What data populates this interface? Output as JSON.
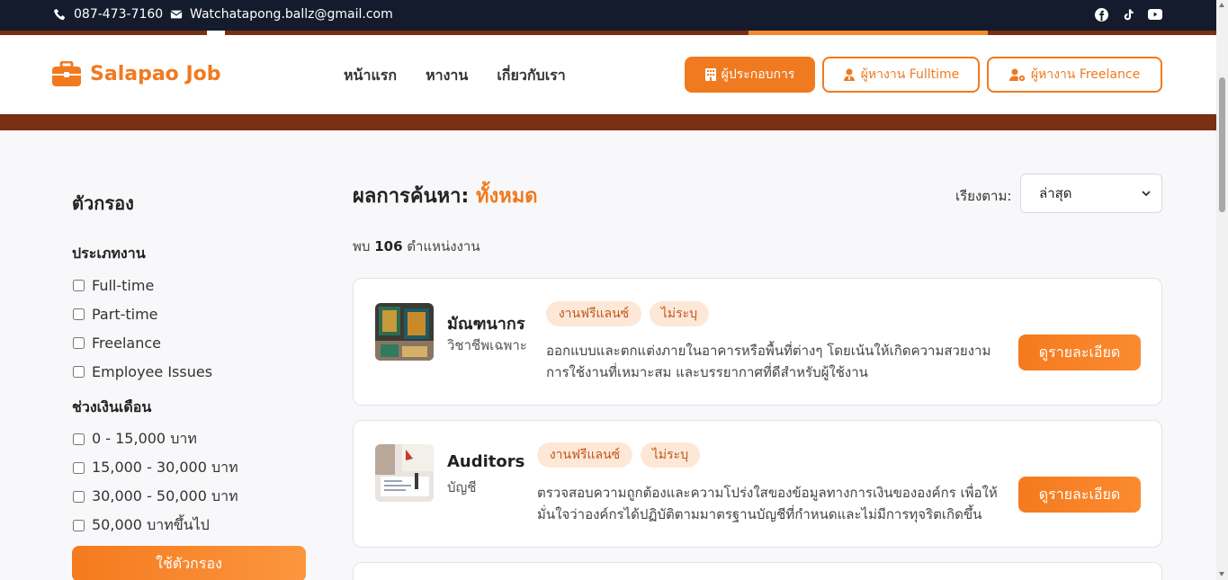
{
  "topbar": {
    "phone": "087-473-7160",
    "email": "Watchatapong.ballz@gmail.com",
    "social": [
      "facebook-icon",
      "tiktok-icon",
      "youtube-icon"
    ]
  },
  "header": {
    "brand": "Salapao Job",
    "nav": [
      "หน้าแรก",
      "หางาน",
      "เกี่ยวกับเรา"
    ],
    "buttons": {
      "employer": "ผู้ประกอบการ",
      "fulltime": "ผู้หางาน Fulltime",
      "freelance": "ผู้หางาน Freelance"
    }
  },
  "filters": {
    "title": "ตัวกรอง",
    "job_type": {
      "heading": "ประเภทงาน",
      "options": [
        "Full-time",
        "Part-time",
        "Freelance",
        "Employee Issues"
      ]
    },
    "salary": {
      "heading": "ช่วงเงินเดือน",
      "options": [
        "0 - 15,000 บาท",
        "15,000 - 30,000 บาท",
        "30,000 - 50,000 บาท",
        "50,000 บาทขึ้นไป"
      ]
    },
    "apply_label": "ใช้ตัวกรอง"
  },
  "results": {
    "title_prefix": "ผลการค้นหา:",
    "title_accent": "ทั้งหมด",
    "sort_label": "เรียงตาม:",
    "sort_value": "ล่าสุด",
    "count_prefix": "พบ",
    "count": "106",
    "count_suffix": "ตำแหน่งงาน",
    "jobs": [
      {
        "title": "มัณฑนากร",
        "category": "วิชาชีพเฉพาะ",
        "tags": [
          "งานฟรีแลนซ์",
          "ไม่ระบุ"
        ],
        "description": "ออกแบบและตกแต่งภายในอาคารหรือพื้นที่ต่างๆ โดยเน้นให้เกิดความสวยงาม การใช้งานที่เหมาะสม และบรรยากาศที่ดีสำหรับผู้ใช้งาน",
        "button": "ดูรายละเอียด"
      },
      {
        "title": "Auditors",
        "category": "บัญชี",
        "tags": [
          "งานฟรีแลนซ์",
          "ไม่ระบุ"
        ],
        "description": "ตรวจสอบความถูกต้องและความโปร่งใสของข้อมูลทางการเงินขององค์กร เพื่อให้มั่นใจว่าองค์กรได้ปฏิบัติตามมาตรฐานบัญชีที่กำหนดและไม่มีการทุจริตเกิดขึ้น",
        "button": "ดูรายละเอียด"
      }
    ]
  },
  "colors": {
    "accent": "#f07a1f",
    "topbar": "#141b2d",
    "band": "#7a2e12",
    "tag_bg": "#fde8d8"
  }
}
